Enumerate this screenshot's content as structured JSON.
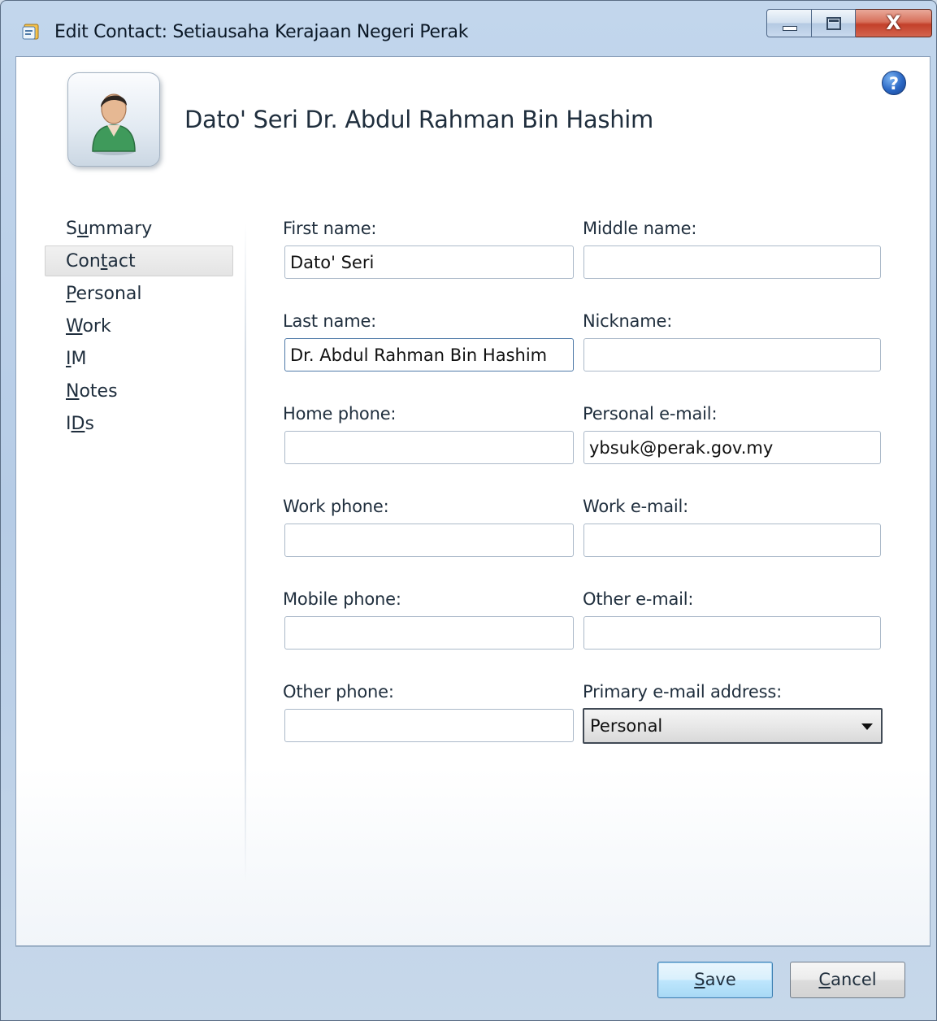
{
  "window": {
    "title": "Edit Contact: Setiausaha Kerajaan Negeri Perak",
    "controls": {
      "minimize_icon": "minimize-icon",
      "maximize_icon": "maximize-icon",
      "close_glyph": "X"
    }
  },
  "header": {
    "contact_name": "Dato' Seri Dr. Abdul Rahman Bin Hashim",
    "help_glyph": "?"
  },
  "nav": {
    "items": [
      {
        "pre": "S",
        "key": "u",
        "post": "mmary"
      },
      {
        "pre": "Con",
        "key": "t",
        "post": "act"
      },
      {
        "pre": "",
        "key": "P",
        "post": "ersonal"
      },
      {
        "pre": "",
        "key": "W",
        "post": "ork"
      },
      {
        "pre": "",
        "key": "I",
        "post": "M"
      },
      {
        "pre": "",
        "key": "N",
        "post": "otes"
      },
      {
        "pre": "I",
        "key": "D",
        "post": "s"
      }
    ],
    "selected_index": 1
  },
  "form": {
    "first_name": {
      "label": "First name:",
      "value": "Dato' Seri"
    },
    "middle_name": {
      "label": "Middle name:",
      "value": ""
    },
    "last_name": {
      "label": "Last name:",
      "value": "Dr. Abdul Rahman Bin Hashim"
    },
    "nickname": {
      "label": "Nickname:",
      "value": ""
    },
    "home_phone": {
      "label": "Home phone:",
      "value": ""
    },
    "personal_email": {
      "label": "Personal e-mail:",
      "value": "ybsuk@perak.gov.my"
    },
    "work_phone": {
      "label": "Work phone:",
      "value": ""
    },
    "work_email": {
      "label": "Work e-mail:",
      "value": ""
    },
    "mobile_phone": {
      "label": "Mobile phone:",
      "value": ""
    },
    "other_email": {
      "label": "Other e-mail:",
      "value": ""
    },
    "other_phone": {
      "label": "Other phone:",
      "value": ""
    },
    "primary_email": {
      "label": "Primary e-mail address:",
      "selected": "Personal"
    }
  },
  "buttons": {
    "save": {
      "key": "S",
      "rest": "ave"
    },
    "cancel": {
      "key": "C",
      "rest": "ancel"
    }
  },
  "colors": {
    "window_frame": "#b6cce6",
    "close_button": "#c3402a",
    "default_button": "#a7d9f5"
  }
}
